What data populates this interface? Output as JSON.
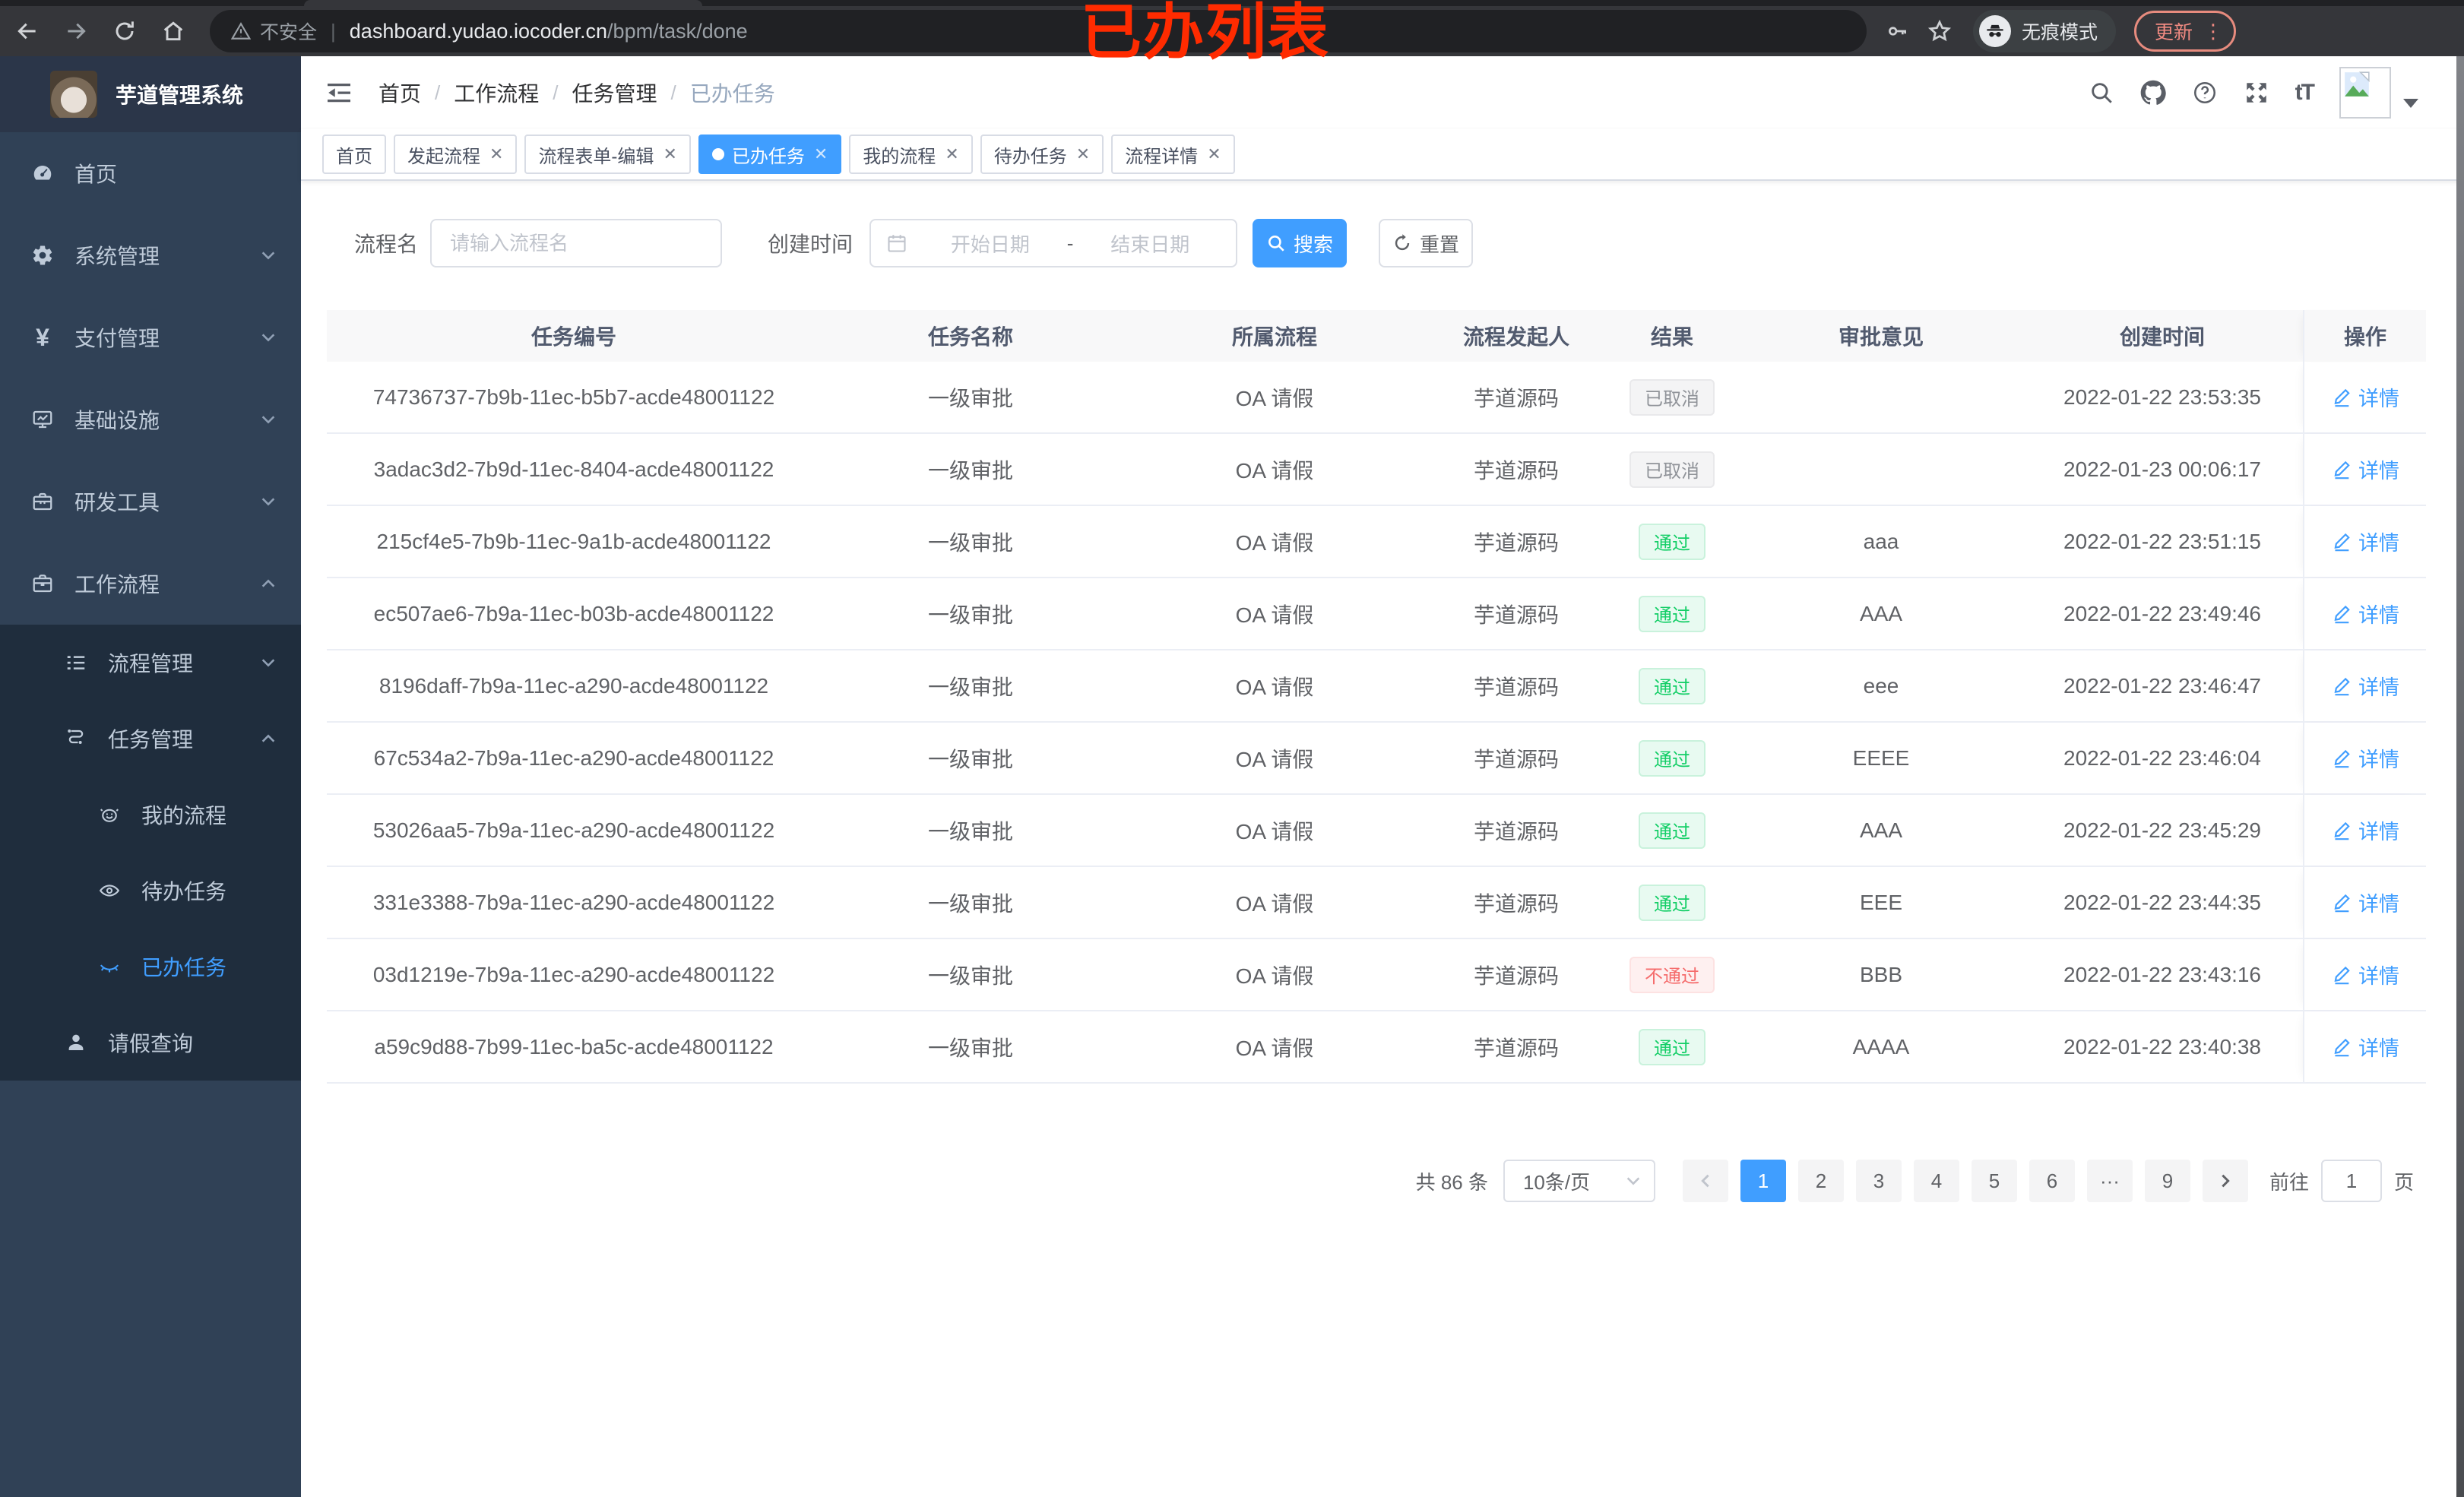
{
  "browser": {
    "security_label": "不安全",
    "url_domain": "dashboard.yudao.iocoder.cn",
    "url_path": "/bpm/task/done",
    "incognito_label": "无痕模式",
    "update_label": "更新",
    "update_dots": "⋮",
    "annotation": "已办列表"
  },
  "sidebar": {
    "logo_title": "芋道管理系统",
    "items": [
      {
        "label": "首页"
      },
      {
        "label": "系统管理"
      },
      {
        "label": "支付管理",
        "icon_char": "¥"
      },
      {
        "label": "基础设施"
      },
      {
        "label": "研发工具"
      },
      {
        "label": "工作流程"
      },
      {
        "label": "流程管理"
      },
      {
        "label": "任务管理"
      },
      {
        "label": "我的流程"
      },
      {
        "label": "待办任务"
      },
      {
        "label": "已办任务"
      },
      {
        "label": "请假查询"
      }
    ]
  },
  "navbar": {
    "breadcrumb": [
      "首页",
      "工作流程",
      "任务管理",
      "已办任务"
    ],
    "separator": "/",
    "font_icon_label": "tT"
  },
  "tabs": [
    {
      "label": "首页"
    },
    {
      "label": "发起流程"
    },
    {
      "label": "流程表单-编辑"
    },
    {
      "label": "已办任务"
    },
    {
      "label": "我的流程"
    },
    {
      "label": "待办任务"
    },
    {
      "label": "流程详情"
    }
  ],
  "filters": {
    "process_name_label": "流程名",
    "process_name_placeholder": "请输入流程名",
    "create_time_label": "创建时间",
    "start_placeholder": "开始日期",
    "range_separator": "-",
    "end_placeholder": "结束日期",
    "search_label": "搜索",
    "reset_label": "重置"
  },
  "table": {
    "columns": [
      "任务编号",
      "任务名称",
      "所属流程",
      "流程发起人",
      "结果",
      "审批意见",
      "创建时间",
      "操作"
    ],
    "detail_label": "详情",
    "rows": [
      {
        "id": "74736737-7b9b-11ec-b5b7-acde48001122",
        "name": "一级审批",
        "process": "OA 请假",
        "starter": "芋道源码",
        "result": "已取消",
        "result_type": "info",
        "opinion": "",
        "time": "2022-01-22 23:53:35"
      },
      {
        "id": "3adac3d2-7b9d-11ec-8404-acde48001122",
        "name": "一级审批",
        "process": "OA 请假",
        "starter": "芋道源码",
        "result": "已取消",
        "result_type": "info",
        "opinion": "",
        "time": "2022-01-23 00:06:17"
      },
      {
        "id": "215cf4e5-7b9b-11ec-9a1b-acde48001122",
        "name": "一级审批",
        "process": "OA 请假",
        "starter": "芋道源码",
        "result": "通过",
        "result_type": "success",
        "opinion": "aaa",
        "time": "2022-01-22 23:51:15"
      },
      {
        "id": "ec507ae6-7b9a-11ec-b03b-acde48001122",
        "name": "一级审批",
        "process": "OA 请假",
        "starter": "芋道源码",
        "result": "通过",
        "result_type": "success",
        "opinion": "AAA",
        "time": "2022-01-22 23:49:46"
      },
      {
        "id": "8196daff-7b9a-11ec-a290-acde48001122",
        "name": "一级审批",
        "process": "OA 请假",
        "starter": "芋道源码",
        "result": "通过",
        "result_type": "success",
        "opinion": "eee",
        "time": "2022-01-22 23:46:47"
      },
      {
        "id": "67c534a2-7b9a-11ec-a290-acde48001122",
        "name": "一级审批",
        "process": "OA 请假",
        "starter": "芋道源码",
        "result": "通过",
        "result_type": "success",
        "opinion": "EEEE",
        "time": "2022-01-22 23:46:04"
      },
      {
        "id": "53026aa5-7b9a-11ec-a290-acde48001122",
        "name": "一级审批",
        "process": "OA 请假",
        "starter": "芋道源码",
        "result": "通过",
        "result_type": "success",
        "opinion": "AAA",
        "time": "2022-01-22 23:45:29"
      },
      {
        "id": "331e3388-7b9a-11ec-a290-acde48001122",
        "name": "一级审批",
        "process": "OA 请假",
        "starter": "芋道源码",
        "result": "通过",
        "result_type": "success",
        "opinion": "EEE",
        "time": "2022-01-22 23:44:35"
      },
      {
        "id": "03d1219e-7b9a-11ec-a290-acde48001122",
        "name": "一级审批",
        "process": "OA 请假",
        "starter": "芋道源码",
        "result": "不通过",
        "result_type": "danger",
        "opinion": "BBB",
        "time": "2022-01-22 23:43:16"
      },
      {
        "id": "a59c9d88-7b99-11ec-ba5c-acde48001122",
        "name": "一级审批",
        "process": "OA 请假",
        "starter": "芋道源码",
        "result": "通过",
        "result_type": "success",
        "opinion": "AAAA",
        "time": "2022-01-22 23:40:38"
      }
    ]
  },
  "pagination": {
    "total_text": "共 86 条",
    "page_size": "10条/页",
    "pages": [
      "1",
      "2",
      "3",
      "4",
      "5",
      "6",
      "···",
      "9"
    ],
    "active_page": "1",
    "goto_label": "前往",
    "goto_value": "1",
    "page_unit": "页"
  },
  "colors": {
    "accent": "#409eff",
    "success": "#13ce66",
    "danger": "#f56c6c",
    "info": "#909399",
    "sidebar_bg": "#304156",
    "submenu_bg": "#1f2d3d",
    "chrome_bg": "#35363a",
    "annotation_red": "#ff2b00"
  }
}
